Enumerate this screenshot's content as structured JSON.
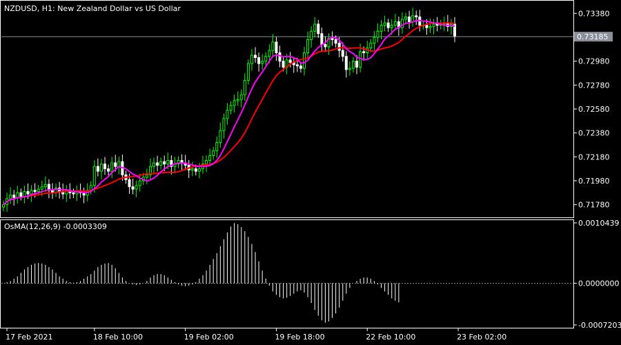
{
  "chart_data": [
    {
      "type": "candlestick",
      "title": "NZDUSD, H1:  New Zealand Dollar vs US Dollar",
      "ylim": [
        0.7168,
        0.7348
      ],
      "y_ticks": [
        {
          "label": "0.73380",
          "value": 0.7338
        },
        {
          "label": "0.72980",
          "value": 0.7298
        },
        {
          "label": "0.72780",
          "value": 0.7278
        },
        {
          "label": "0.72580",
          "value": 0.7258
        },
        {
          "label": "0.72380",
          "value": 0.7238
        },
        {
          "label": "0.72180",
          "value": 0.7218
        },
        {
          "label": "0.71980",
          "value": 0.7198
        },
        {
          "label": "0.71780",
          "value": 0.7178
        }
      ],
      "current_price": {
        "label": "0.73185",
        "value": 0.73185
      },
      "x_ticks": [
        {
          "label": "17 Feb 2021",
          "index": 1
        },
        {
          "label": "18 Feb 2021 10:00",
          "display": "18 Feb 10:00",
          "index": 26
        },
        {
          "label": "19 Feb 02:00",
          "index": 52
        },
        {
          "label": "19 Feb 18:00",
          "index": 78
        },
        {
          "label": "22 Feb 10:00",
          "index": 104
        },
        {
          "label": "23 Feb 02:00",
          "index": 130
        }
      ],
      "candle_colors": {
        "bull": "#00ff00",
        "bear": "#ffffff",
        "bull_body": "#000000",
        "bear_body": "#ffffff"
      },
      "ma_colors": {
        "fast": "#ff00ff",
        "slow": "#ff0000"
      },
      "close": [
        0.7178,
        0.7183,
        0.7186,
        0.7184,
        0.7188,
        0.7185,
        0.7189,
        0.7187,
        0.719,
        0.7189,
        0.7191,
        0.7193,
        0.7195,
        0.719,
        0.7188,
        0.7192,
        0.7189,
        0.7187,
        0.719,
        0.7188,
        0.7187,
        0.7189,
        0.7188,
        0.7186,
        0.719,
        0.7194,
        0.721,
        0.7206,
        0.7212,
        0.7208,
        0.7206,
        0.7213,
        0.721,
        0.7214,
        0.7203,
        0.7199,
        0.7193,
        0.7191,
        0.7194,
        0.7198,
        0.7201,
        0.7203,
        0.721,
        0.7213,
        0.7211,
        0.7214,
        0.7212,
        0.7215,
        0.721,
        0.7212,
        0.7215,
        0.7213,
        0.7211,
        0.7207,
        0.7208,
        0.7206,
        0.7208,
        0.7212,
        0.7215,
        0.7219,
        0.7223,
        0.723,
        0.724,
        0.725,
        0.7257,
        0.7261,
        0.7265,
        0.7266,
        0.727,
        0.7282,
        0.7296,
        0.7303,
        0.7301,
        0.7296,
        0.7298,
        0.7302,
        0.7307,
        0.7314,
        0.7305,
        0.7298,
        0.7293,
        0.7299,
        0.7297,
        0.7295,
        0.7294,
        0.7292,
        0.7305,
        0.7316,
        0.7323,
        0.7329,
        0.7321,
        0.7312,
        0.731,
        0.7317,
        0.7316,
        0.7313,
        0.7307,
        0.7302,
        0.7291,
        0.7292,
        0.7298,
        0.7293,
        0.7306,
        0.7305,
        0.7309,
        0.7313,
        0.7318,
        0.7323,
        0.7328,
        0.733,
        0.7326,
        0.7328,
        0.7331,
        0.7326,
        0.7333,
        0.7335,
        0.7331,
        0.7336,
        0.7335,
        0.7328,
        0.7328,
        0.7326,
        0.7327,
        0.7329,
        0.7328,
        0.7329,
        0.733,
        0.7327,
        0.7329,
        0.7319
      ],
      "open": [
        0.7176,
        0.7178,
        0.7183,
        0.7186,
        0.7184,
        0.7188,
        0.7185,
        0.7189,
        0.7187,
        0.719,
        0.7189,
        0.7191,
        0.7193,
        0.7195,
        0.719,
        0.7188,
        0.7192,
        0.7189,
        0.7187,
        0.719,
        0.7188,
        0.7187,
        0.7189,
        0.7188,
        0.7186,
        0.719,
        0.7194,
        0.721,
        0.7206,
        0.7212,
        0.7208,
        0.7206,
        0.7213,
        0.721,
        0.7214,
        0.7203,
        0.7199,
        0.7193,
        0.7191,
        0.7194,
        0.7198,
        0.7201,
        0.7203,
        0.721,
        0.7213,
        0.7211,
        0.7214,
        0.7212,
        0.7215,
        0.721,
        0.7212,
        0.7215,
        0.7213,
        0.7211,
        0.7207,
        0.7208,
        0.7206,
        0.7208,
        0.7212,
        0.7215,
        0.7219,
        0.7223,
        0.723,
        0.724,
        0.725,
        0.7257,
        0.7261,
        0.7265,
        0.7266,
        0.727,
        0.7282,
        0.7296,
        0.7303,
        0.7301,
        0.7296,
        0.7298,
        0.7302,
        0.7307,
        0.7314,
        0.7305,
        0.7298,
        0.7293,
        0.7299,
        0.7297,
        0.7295,
        0.7294,
        0.7292,
        0.7305,
        0.7316,
        0.7323,
        0.7329,
        0.7321,
        0.7312,
        0.731,
        0.7317,
        0.7316,
        0.7313,
        0.7307,
        0.7302,
        0.7291,
        0.7292,
        0.7298,
        0.7293,
        0.7306,
        0.7305,
        0.7309,
        0.7313,
        0.7318,
        0.7323,
        0.7328,
        0.733,
        0.7326,
        0.7328,
        0.7331,
        0.7326,
        0.7333,
        0.7335,
        0.7331,
        0.7336,
        0.7335,
        0.7328,
        0.7328,
        0.7326,
        0.7327,
        0.7329,
        0.7328,
        0.7329,
        0.733,
        0.7327,
        0.7329
      ]
    },
    {
      "type": "histogram",
      "title": "OsMA(12,26,9) -0.0003309",
      "ylim": [
        -0.0007203,
        0.0010439
      ],
      "y_ticks": [
        {
          "label": "0.0010439",
          "value": 0.0010439
        },
        {
          "label": "0.0000000",
          "value": 0.0
        },
        {
          "label": "-0.0007203",
          "value": -0.0007203
        }
      ],
      "values": [
        0.0,
        2e-05,
        4e-05,
        8e-05,
        0.00012,
        0.00018,
        0.00024,
        0.00028,
        0.00032,
        0.00034,
        0.00035,
        0.00034,
        0.00032,
        0.00028,
        0.00024,
        0.00018,
        0.00012,
        8e-05,
        4e-05,
        2e-05,
        1e-05,
        2e-05,
        4e-05,
        8e-05,
        0.00012,
        0.00016,
        0.00022,
        0.00028,
        0.00032,
        0.00034,
        0.00035,
        0.00032,
        0.00026,
        0.00018,
        0.0001,
        4e-05,
        0.0,
        -2e-05,
        -3e-05,
        -2e-05,
        0.0,
        4e-05,
        0.0001,
        0.00014,
        0.00016,
        0.00016,
        0.00014,
        0.0001,
        6e-05,
        2e-05,
        -2e-05,
        -4e-05,
        -5e-05,
        -4e-05,
        -2e-05,
        2e-05,
        8e-05,
        0.00014,
        0.00022,
        0.00032,
        0.00042,
        0.00052,
        0.00064,
        0.00076,
        0.00088,
        0.00098,
        0.00104,
        0.00102,
        0.00097,
        0.0009,
        0.0008,
        0.00068,
        0.00054,
        0.00038,
        0.00022,
        8e-05,
        -4e-05,
        -0.00014,
        -0.0002,
        -0.00024,
        -0.00026,
        -0.00025,
        -0.00022,
        -0.00018,
        -0.00014,
        -0.00012,
        -0.00016,
        -0.00024,
        -0.00034,
        -0.00046,
        -0.00056,
        -0.00064,
        -0.00068,
        -0.00066,
        -0.0006,
        -0.00052,
        -0.00042,
        -0.0003,
        -0.00018,
        -8e-05,
        0.0,
        4e-05,
        8e-05,
        0.0001,
        0.0001,
        8e-05,
        4e-05,
        -2e-05,
        -8e-05,
        -0.00014,
        -0.0002,
        -0.00026,
        -0.0003,
        -0.00033
      ]
    }
  ]
}
